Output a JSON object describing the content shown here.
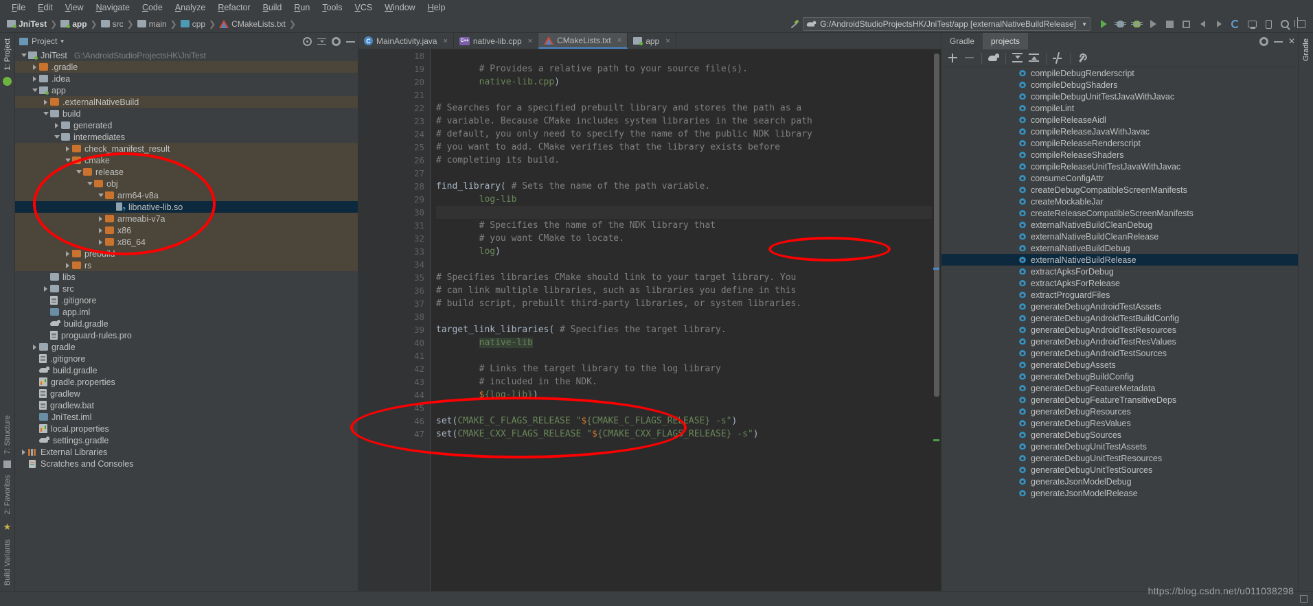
{
  "menubar": {
    "items": [
      "File",
      "Edit",
      "View",
      "Navigate",
      "Code",
      "Analyze",
      "Refactor",
      "Build",
      "Run",
      "Tools",
      "VCS",
      "Window",
      "Help"
    ]
  },
  "breadcrumb": {
    "items": [
      {
        "label": "JniTest",
        "icon": "module-icon"
      },
      {
        "label": "app",
        "icon": "module-icon"
      },
      {
        "label": "src",
        "icon": "folder-icon"
      },
      {
        "label": "main",
        "icon": "folder-icon"
      },
      {
        "label": "cpp",
        "icon": "folder-cyan-icon"
      },
      {
        "label": "CMakeLists.txt",
        "icon": "cmake-icon"
      }
    ],
    "separator": "❯"
  },
  "toolbar": {
    "run_config": "G:/AndroidStudioProjectsHK/JniTest/app [externalNativeBuildRelease]",
    "run_config_caret": "▼",
    "buttons": [
      "make-project-icon",
      "run-icon",
      "debug-icon",
      "attach-debugger-icon",
      "run-tests-icon",
      "stop-icon",
      "pause-icon",
      "back-icon",
      "forward-icon",
      "avd-manager-icon",
      "sdk-manager-icon",
      "sync-gradle-icon",
      "search-icon",
      "layout-icon"
    ]
  },
  "left_rail": {
    "top": [
      "1: Project",
      "android-robot-icon"
    ],
    "bottom": [
      "7: Structure",
      "2: Favorites",
      "Build Variants"
    ]
  },
  "right_rail": {
    "items": [
      "Gradle"
    ]
  },
  "project_panel": {
    "title": "Project",
    "caret": "▾",
    "header_icons": [
      "locate-icon",
      "collapse-all-icon",
      "settings-icon",
      "hide-icon"
    ],
    "tree": [
      {
        "depth": 0,
        "twisty": "down",
        "icon": "module-icon",
        "label": "JniTest",
        "path": "G:\\AndroidStudioProjectsHK\\JniTest",
        "state": "normal"
      },
      {
        "depth": 1,
        "twisty": "right",
        "icon": "folder-orange-icon",
        "label": ".gradle",
        "path": "",
        "state": "excluded"
      },
      {
        "depth": 1,
        "twisty": "right",
        "icon": "folder-icon",
        "label": ".idea",
        "path": "",
        "state": "normal"
      },
      {
        "depth": 1,
        "twisty": "down",
        "icon": "module-icon",
        "label": "app",
        "path": "",
        "state": "normal"
      },
      {
        "depth": 2,
        "twisty": "right",
        "icon": "folder-orange-icon",
        "label": ".externalNativeBuild",
        "path": "",
        "state": "excluded"
      },
      {
        "depth": 2,
        "twisty": "down",
        "icon": "folder-icon",
        "label": "build",
        "path": "",
        "state": "normal"
      },
      {
        "depth": 3,
        "twisty": "right",
        "icon": "folder-icon",
        "label": "generated",
        "path": "",
        "state": "normal"
      },
      {
        "depth": 3,
        "twisty": "down",
        "icon": "folder-icon",
        "label": "intermediates",
        "path": "",
        "state": "normal"
      },
      {
        "depth": 4,
        "twisty": "right",
        "icon": "folder-orange-icon",
        "label": "check_manifest_result",
        "path": "",
        "state": "excluded"
      },
      {
        "depth": 4,
        "twisty": "down",
        "icon": "folder-orange-icon",
        "label": "cmake",
        "path": "",
        "state": "excluded"
      },
      {
        "depth": 5,
        "twisty": "down",
        "icon": "folder-orange-icon",
        "label": "release",
        "path": "",
        "state": "excluded"
      },
      {
        "depth": 6,
        "twisty": "down",
        "icon": "folder-orange-icon",
        "label": "obj",
        "path": "",
        "state": "excluded"
      },
      {
        "depth": 7,
        "twisty": "down",
        "icon": "folder-orange-icon",
        "label": "arm64-v8a",
        "path": "",
        "state": "excluded"
      },
      {
        "depth": 8,
        "twisty": "none",
        "icon": "so-file-icon",
        "label": "libnative-lib.so",
        "path": "",
        "state": "selected"
      },
      {
        "depth": 7,
        "twisty": "right",
        "icon": "folder-orange-icon",
        "label": "armeabi-v7a",
        "path": "",
        "state": "excluded"
      },
      {
        "depth": 7,
        "twisty": "right",
        "icon": "folder-orange-icon",
        "label": "x86",
        "path": "",
        "state": "excluded"
      },
      {
        "depth": 7,
        "twisty": "right",
        "icon": "folder-orange-icon",
        "label": "x86_64",
        "path": "",
        "state": "excluded"
      },
      {
        "depth": 4,
        "twisty": "right",
        "icon": "folder-orange-icon",
        "label": "prebuild",
        "path": "",
        "state": "excluded"
      },
      {
        "depth": 4,
        "twisty": "right",
        "icon": "folder-orange-icon",
        "label": "rs",
        "path": "",
        "state": "excluded"
      },
      {
        "depth": 2,
        "twisty": "none",
        "icon": "folder-icon",
        "label": "libs",
        "path": "",
        "state": "normal"
      },
      {
        "depth": 2,
        "twisty": "right",
        "icon": "folder-icon",
        "label": "src",
        "path": "",
        "state": "normal"
      },
      {
        "depth": 2,
        "twisty": "none",
        "icon": "file-icon",
        "label": ".gitignore",
        "path": "",
        "state": "normal"
      },
      {
        "depth": 2,
        "twisty": "none",
        "icon": "iml-icon",
        "label": "app.iml",
        "path": "",
        "state": "normal"
      },
      {
        "depth": 2,
        "twisty": "none",
        "icon": "gradle-icon",
        "label": "build.gradle",
        "path": "",
        "state": "normal"
      },
      {
        "depth": 2,
        "twisty": "none",
        "icon": "file-icon",
        "label": "proguard-rules.pro",
        "path": "",
        "state": "normal"
      },
      {
        "depth": 1,
        "twisty": "right",
        "icon": "folder-icon",
        "label": "gradle",
        "path": "",
        "state": "normal"
      },
      {
        "depth": 1,
        "twisty": "none",
        "icon": "file-icon",
        "label": ".gitignore",
        "path": "",
        "state": "normal"
      },
      {
        "depth": 1,
        "twisty": "none",
        "icon": "gradle-icon",
        "label": "build.gradle",
        "path": "",
        "state": "normal"
      },
      {
        "depth": 1,
        "twisty": "none",
        "icon": "props-icon",
        "label": "gradle.properties",
        "path": "",
        "state": "normal"
      },
      {
        "depth": 1,
        "twisty": "none",
        "icon": "file-icon",
        "label": "gradlew",
        "path": "",
        "state": "normal"
      },
      {
        "depth": 1,
        "twisty": "none",
        "icon": "file-icon",
        "label": "gradlew.bat",
        "path": "",
        "state": "normal"
      },
      {
        "depth": 1,
        "twisty": "none",
        "icon": "iml-icon",
        "label": "JniTest.iml",
        "path": "",
        "state": "normal"
      },
      {
        "depth": 1,
        "twisty": "none",
        "icon": "props-icon",
        "label": "local.properties",
        "path": "",
        "state": "normal"
      },
      {
        "depth": 1,
        "twisty": "none",
        "icon": "gradle-icon",
        "label": "settings.gradle",
        "path": "",
        "state": "normal"
      },
      {
        "depth": 0,
        "twisty": "right",
        "icon": "lib-icon",
        "label": "External Libraries",
        "path": "",
        "state": "normal"
      },
      {
        "depth": 0,
        "twisty": "none",
        "icon": "scratch-icon",
        "label": "Scratches and Consoles",
        "path": "",
        "state": "normal"
      }
    ]
  },
  "editor": {
    "tabs": [
      {
        "label": "MainActivity.java",
        "icon": "java-icon",
        "active": false,
        "close": "×"
      },
      {
        "label": "native-lib.cpp",
        "icon": "cpp-icon",
        "active": false,
        "close": "×"
      },
      {
        "label": "CMakeLists.txt",
        "icon": "cmake-icon",
        "active": true,
        "close": "×"
      },
      {
        "label": "app",
        "icon": "module-icon",
        "active": false,
        "close": "×"
      }
    ],
    "first_line_number": 18,
    "lines": [
      {
        "no": 18,
        "text": "",
        "type": "blank"
      },
      {
        "no": 19,
        "text": "        # Provides a relative path to your source file(s).",
        "type": "comment"
      },
      {
        "no": 20,
        "text": "        native-lib.cpp)",
        "type": "mixed-str"
      },
      {
        "no": 21,
        "text": "",
        "type": "blank"
      },
      {
        "no": 22,
        "text": "# Searches for a specified prebuilt library and stores the path as a",
        "type": "comment"
      },
      {
        "no": 23,
        "text": "# variable. Because CMake includes system libraries in the search path",
        "type": "comment"
      },
      {
        "no": 24,
        "text": "# default, you only need to specify the name of the public NDK library",
        "type": "comment"
      },
      {
        "no": 25,
        "text": "# you want to add. CMake verifies that the library exists before",
        "type": "comment"
      },
      {
        "no": 26,
        "text": "# completing its build.",
        "type": "comment"
      },
      {
        "no": 27,
        "text": "",
        "type": "blank"
      },
      {
        "no": 28,
        "text": "find_library( # Sets the name of the path variable.",
        "type": "fn-comment"
      },
      {
        "no": 29,
        "text": "        log-lib",
        "type": "var"
      },
      {
        "no": 30,
        "text": "",
        "type": "blank",
        "selected": true
      },
      {
        "no": 31,
        "text": "        # Specifies the name of the NDK library that",
        "type": "comment"
      },
      {
        "no": 32,
        "text": "        # you want CMake to locate.",
        "type": "comment"
      },
      {
        "no": 33,
        "text": "        log)",
        "type": "var-paren"
      },
      {
        "no": 34,
        "text": "",
        "type": "blank"
      },
      {
        "no": 35,
        "text": "# Specifies libraries CMake should link to your target library. You",
        "type": "comment"
      },
      {
        "no": 36,
        "text": "# can link multiple libraries, such as libraries you define in this",
        "type": "comment"
      },
      {
        "no": 37,
        "text": "# build script, prebuilt third-party libraries, or system libraries.",
        "type": "comment"
      },
      {
        "no": 38,
        "text": "",
        "type": "blank"
      },
      {
        "no": 39,
        "text": "target_link_libraries( # Specifies the target library.",
        "type": "fn-comment"
      },
      {
        "no": 40,
        "text": "        native-lib",
        "type": "var-hl"
      },
      {
        "no": 41,
        "text": "",
        "type": "blank"
      },
      {
        "no": 42,
        "text": "        # Links the target library to the log library",
        "type": "comment"
      },
      {
        "no": 43,
        "text": "        # included in the NDK.",
        "type": "comment"
      },
      {
        "no": 44,
        "text": "        ${log-lib})",
        "type": "dollar-var"
      },
      {
        "no": 45,
        "text": "",
        "type": "blank"
      },
      {
        "no": 46,
        "text": "set(CMAKE_C_FLAGS_RELEASE \"${CMAKE_C_FLAGS_RELEASE} -s\")",
        "type": "set-line"
      },
      {
        "no": 47,
        "text": "set(CMAKE_CXX_FLAGS_RELEASE \"${CMAKE_CXX_FLAGS_RELEASE} -s\")",
        "type": "set-line"
      }
    ]
  },
  "gradle_panel": {
    "tabs": [
      {
        "label": "Gradle",
        "active": false
      },
      {
        "label": "projects",
        "active": true
      }
    ],
    "header_icons": [
      "settings-icon",
      "hide-icon",
      "close-icon"
    ],
    "toolbar_buttons": [
      "add-icon",
      "remove-icon",
      "execute-gradle-task-icon",
      "expand-all-icon",
      "collapse-all-icon",
      "toggle-offline-icon",
      "gradle-settings-icon"
    ],
    "tasks": [
      {
        "label": "compileDebugRenderscript",
        "selected": false
      },
      {
        "label": "compileDebugShaders",
        "selected": false
      },
      {
        "label": "compileDebugUnitTestJavaWithJavac",
        "selected": false
      },
      {
        "label": "compileLint",
        "selected": false
      },
      {
        "label": "compileReleaseAidl",
        "selected": false
      },
      {
        "label": "compileReleaseJavaWithJavac",
        "selected": false
      },
      {
        "label": "compileReleaseRenderscript",
        "selected": false
      },
      {
        "label": "compileReleaseShaders",
        "selected": false
      },
      {
        "label": "compileReleaseUnitTestJavaWithJavac",
        "selected": false
      },
      {
        "label": "consumeConfigAttr",
        "selected": false
      },
      {
        "label": "createDebugCompatibleScreenManifests",
        "selected": false
      },
      {
        "label": "createMockableJar",
        "selected": false
      },
      {
        "label": "createReleaseCompatibleScreenManifests",
        "selected": false
      },
      {
        "label": "externalNativeBuildCleanDebug",
        "selected": false
      },
      {
        "label": "externalNativeBuildCleanRelease",
        "selected": false
      },
      {
        "label": "externalNativeBuildDebug",
        "selected": false
      },
      {
        "label": "externalNativeBuildRelease",
        "selected": true
      },
      {
        "label": "extractApksForDebug",
        "selected": false
      },
      {
        "label": "extractApksForRelease",
        "selected": false
      },
      {
        "label": "extractProguardFiles",
        "selected": false
      },
      {
        "label": "generateDebugAndroidTestAssets",
        "selected": false
      },
      {
        "label": "generateDebugAndroidTestBuildConfig",
        "selected": false
      },
      {
        "label": "generateDebugAndroidTestResources",
        "selected": false
      },
      {
        "label": "generateDebugAndroidTestResValues",
        "selected": false
      },
      {
        "label": "generateDebugAndroidTestSources",
        "selected": false
      },
      {
        "label": "generateDebugAssets",
        "selected": false
      },
      {
        "label": "generateDebugBuildConfig",
        "selected": false
      },
      {
        "label": "generateDebugFeatureMetadata",
        "selected": false
      },
      {
        "label": "generateDebugFeatureTransitiveDeps",
        "selected": false
      },
      {
        "label": "generateDebugResources",
        "selected": false
      },
      {
        "label": "generateDebugResValues",
        "selected": false
      },
      {
        "label": "generateDebugSources",
        "selected": false
      },
      {
        "label": "generateDebugUnitTestAssets",
        "selected": false
      },
      {
        "label": "generateDebugUnitTestResources",
        "selected": false
      },
      {
        "label": "generateDebugUnitTestSources",
        "selected": false
      },
      {
        "label": "generateJsonModelDebug",
        "selected": false
      },
      {
        "label": "generateJsonModelRelease",
        "selected": false
      }
    ]
  },
  "watermark": "https://blog.csdn.net/u011038298",
  "colors": {
    "annotation_red": "#ff0000",
    "selection_blue": "#0d293e",
    "accent_blue": "#3592c4",
    "background": "#3c3f41",
    "editor_bg": "#2b2b2b"
  }
}
